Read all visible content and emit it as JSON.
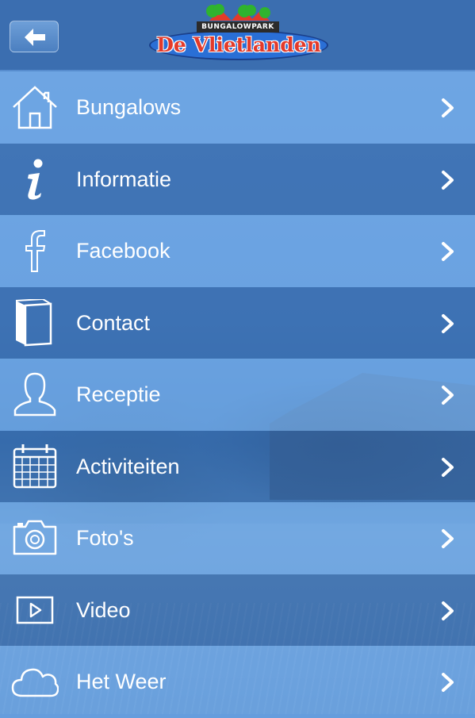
{
  "header": {
    "back_icon": "back-arrow-icon",
    "logo": {
      "top_text": "BUNGALOWPARK",
      "main_text": "De Vlietlanden",
      "colors": {
        "oval": "#2a6fd6",
        "text": "#e33a2a",
        "trees": "#2fb32f",
        "roofs": "#e33a2a"
      }
    }
  },
  "menu": {
    "items": [
      {
        "label": "Bungalows",
        "icon": "home-icon"
      },
      {
        "label": "Informatie",
        "icon": "info-icon"
      },
      {
        "label": "Facebook",
        "icon": "facebook-icon"
      },
      {
        "label": "Contact",
        "icon": "book-icon"
      },
      {
        "label": "Receptie",
        "icon": "person-icon"
      },
      {
        "label": "Activiteiten",
        "icon": "calendar-icon"
      },
      {
        "label": "Foto's",
        "icon": "camera-icon"
      },
      {
        "label": "Video",
        "icon": "video-icon"
      },
      {
        "label": "Het Weer",
        "icon": "cloud-icon"
      }
    ]
  },
  "colors": {
    "header_bg": "#3b6eb0",
    "row_light": "#7db4f0",
    "row_dark": "#2d5fa0",
    "text": "#ffffff"
  }
}
